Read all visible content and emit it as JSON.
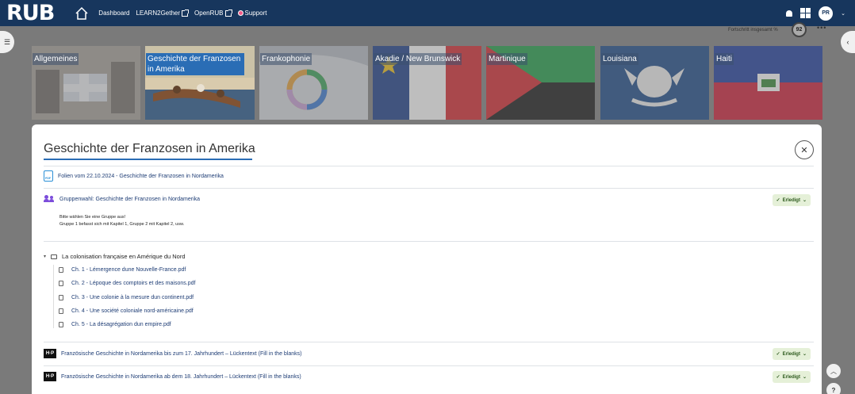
{
  "navbar": {
    "logo": "RUB",
    "links": [
      {
        "label": "Dashboard"
      },
      {
        "label": "LEARN2Gether"
      },
      {
        "label": "OpenRUB"
      },
      {
        "label": "Support"
      }
    ],
    "avatar_initials": "PR"
  },
  "progress": {
    "label": "Fortschritt insgesamt %",
    "value": "92"
  },
  "tiles": [
    {
      "label": "Allgemeines"
    },
    {
      "label": "Geschichte der Franzosen in Amerika"
    },
    {
      "label": "Frankophonie"
    },
    {
      "label": "Akadie / New Brunswick"
    },
    {
      "label": "Martinique"
    },
    {
      "label": "Louisiana"
    },
    {
      "label": "Haiti"
    }
  ],
  "section": {
    "title": "Geschichte der Franzosen in Amerika",
    "close_symbol": "✕",
    "activities": {
      "pdf": {
        "label": "Folien vom 22.10.2024 - Geschichte der Franzosen in Nordamerika",
        "icon_text": "PDF"
      },
      "group": {
        "label": "Gruppenwahl: Geschichte der Franzosen in Nordamerika",
        "status": "Erledigt",
        "desc_line1": "Bitte wählen Sie eine Gruppe aus!",
        "desc_line2": "Gruppe 1 befasst sich mit Kapitel 1, Gruppe 2 mit Kapitel 2, usw."
      },
      "folder": {
        "label": "La colonisation française en Amérique du Nord",
        "files": [
          "Ch. 1 - Lémergence dune Nouvelle-France.pdf",
          "Ch. 2 - Lépoque des comptoirs et des maisons.pdf",
          "Ch. 3 - Une colonie à la mesure dun continent.pdf",
          "Ch. 4 - Une société coloniale nord-américaine.pdf",
          "Ch. 5 - La désagrégation dun empire.pdf"
        ]
      },
      "h5p1": {
        "label": "Französische Geschichte in Nordamerika bis zum 17. Jahrhundert – Lückentext (Fill in the blanks)",
        "status": "Erledigt",
        "icon_text": "H·P"
      },
      "h5p2": {
        "label": "Französische Geschichte in Nordamerika ab dem 18. Jahrhundert – Lückentext (Fill in the blanks)",
        "status": "Erledigt",
        "icon_text": "H·P"
      }
    }
  },
  "help_symbol": "?",
  "colors": {
    "navbar": "#17365d",
    "accent": "#2a6db5",
    "done_badge": "#e5f0d8"
  }
}
